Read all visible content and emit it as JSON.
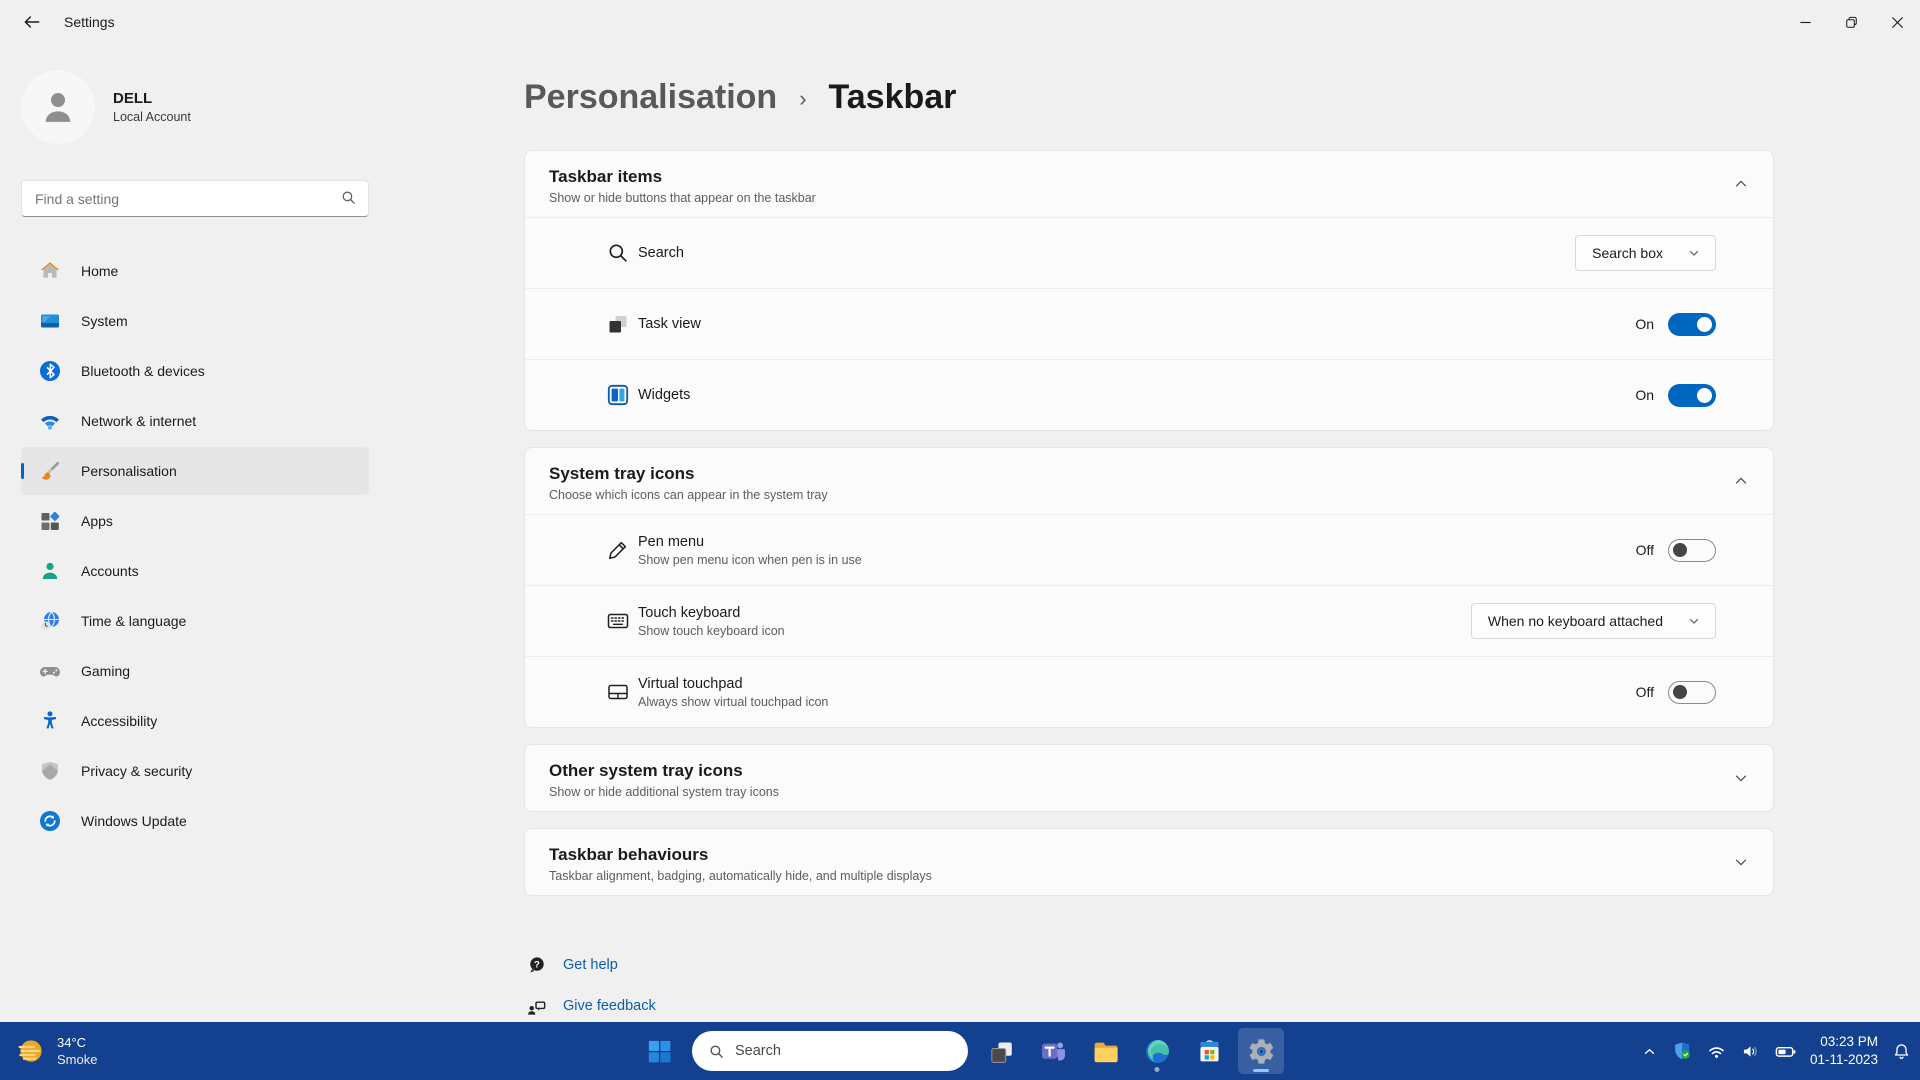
{
  "titlebar": {
    "title": "Settings"
  },
  "user": {
    "name": "DELL",
    "type": "Local Account"
  },
  "sidebar": {
    "search_placeholder": "Find a setting",
    "items": [
      {
        "label": "Home"
      },
      {
        "label": "System"
      },
      {
        "label": "Bluetooth & devices"
      },
      {
        "label": "Network & internet"
      },
      {
        "label": "Personalisation"
      },
      {
        "label": "Apps"
      },
      {
        "label": "Accounts"
      },
      {
        "label": "Time & language"
      },
      {
        "label": "Gaming"
      },
      {
        "label": "Accessibility"
      },
      {
        "label": "Privacy & security"
      },
      {
        "label": "Windows Update"
      }
    ]
  },
  "breadcrumb": {
    "parent": "Personalisation",
    "separator": "›",
    "current": "Taskbar"
  },
  "taskbar_items_card": {
    "title": "Taskbar items",
    "subtitle": "Show or hide buttons that appear on the taskbar",
    "rows": {
      "search": {
        "label": "Search",
        "value": "Search box"
      },
      "task_view": {
        "label": "Task view",
        "state": "On"
      },
      "widgets": {
        "label": "Widgets",
        "state": "On"
      }
    }
  },
  "system_tray_card": {
    "title": "System tray icons",
    "subtitle": "Choose which icons can appear in the system tray",
    "rows": {
      "pen_menu": {
        "label": "Pen menu",
        "description": "Show pen menu icon when pen is in use",
        "state": "Off"
      },
      "touch_keyboard": {
        "label": "Touch keyboard",
        "description": "Show touch keyboard icon",
        "value": "When no keyboard attached"
      },
      "virtual_touchpad": {
        "label": "Virtual touchpad",
        "description": "Always show virtual touchpad icon",
        "state": "Off"
      }
    }
  },
  "other_tray_card": {
    "title": "Other system tray icons",
    "subtitle": "Show or hide additional system tray icons"
  },
  "behaviours_card": {
    "title": "Taskbar behaviours",
    "subtitle": "Taskbar alignment, badging, automatically hide, and multiple displays"
  },
  "footer": {
    "get_help": "Get help",
    "give_feedback": "Give feedback"
  },
  "taskbar": {
    "weather": {
      "temperature": "34°C",
      "condition": "Smoke"
    },
    "search_placeholder": "Search",
    "clock": {
      "time": "03:23 PM",
      "date": "01-11-2023"
    }
  },
  "colors": {
    "accent": "#0067c0",
    "taskbar": "#13418f",
    "link": "#0b5cad"
  }
}
